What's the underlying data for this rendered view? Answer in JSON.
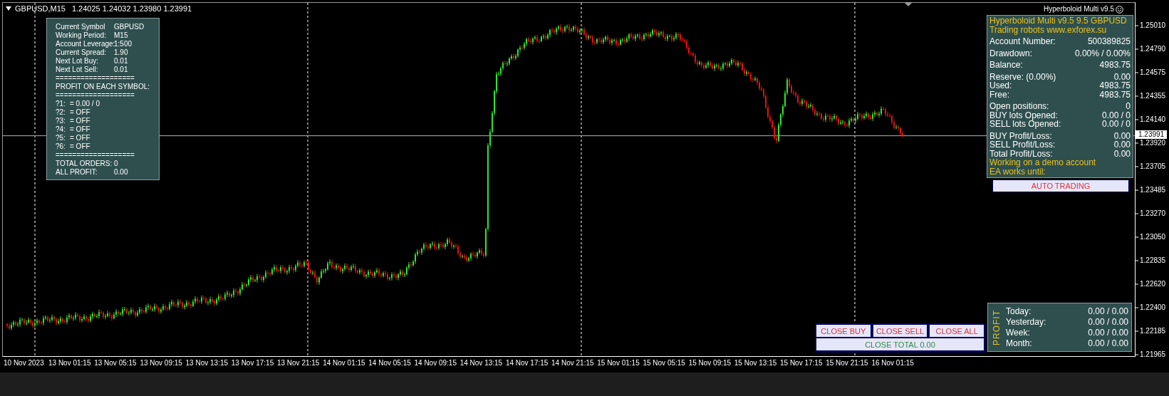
{
  "chart": {
    "symbol_period": "GBPUSD,M15",
    "quote": "1.24025 1.24032 1.23980 1.23991",
    "current_price": "1.23991",
    "price_axis": [
      "1.25010",
      "1.24790",
      "1.24575",
      "1.24355",
      "1.24140",
      "1.23920",
      "1.23705",
      "1.23485",
      "1.23270",
      "1.23050",
      "1.22835",
      "1.22620",
      "1.22400",
      "1.22185",
      "1.21965"
    ],
    "time_axis": [
      "10 Nov 2023",
      "13 Nov 01:15",
      "13 Nov 05:15",
      "13 Nov 09:15",
      "13 Nov 13:15",
      "13 Nov 17:15",
      "13 Nov 21:15",
      "14 Nov 01:15",
      "14 Nov 05:15",
      "14 Nov 09:15",
      "14 Nov 13:15",
      "14 Nov 17:15",
      "14 Nov 21:15",
      "15 Nov 01:15",
      "15 Nov 05:15",
      "15 Nov 09:15",
      "15 Nov 13:15",
      "15 Nov 17:15",
      "15 Nov 21:15",
      "16 Nov 01:15"
    ]
  },
  "info_panel": {
    "lines": [
      {
        "kind": "pair",
        "label": "Current Symbol",
        "value": "GBPUSD"
      },
      {
        "kind": "pair",
        "label": "Working Period:",
        "value": "M15"
      },
      {
        "kind": "pair",
        "label": "Account Leverage:",
        "value": "1:500"
      },
      {
        "kind": "pair",
        "label": "Current Spread:",
        "value": "1.90"
      },
      {
        "kind": "pair",
        "label": "Next Lot Buy:",
        "value": "0.01"
      },
      {
        "kind": "pair",
        "label": "Next Lot Sell:",
        "value": "0.01"
      },
      {
        "kind": "text",
        "text": "==================="
      },
      {
        "kind": "text",
        "text": "PROFIT ON EACH SYMBOL:"
      },
      {
        "kind": "text",
        "text": "==================="
      },
      {
        "kind": "slot",
        "label": "?1:",
        "value": "= 0.00 / 0"
      },
      {
        "kind": "slot",
        "label": "?2:",
        "value": "= OFF"
      },
      {
        "kind": "slot",
        "label": "?3:",
        "value": "= OFF"
      },
      {
        "kind": "slot",
        "label": "?4:",
        "value": "= OFF"
      },
      {
        "kind": "slot",
        "label": "?5:",
        "value": "= OFF"
      },
      {
        "kind": "slot",
        "label": "?6:",
        "value": "= OFF"
      },
      {
        "kind": "text",
        "text": "==================="
      },
      {
        "kind": "pair",
        "label": "TOTAL ORDERS:",
        "value": "0"
      },
      {
        "kind": "pair",
        "label": "ALL PROFIT:",
        "value": "0.00"
      }
    ]
  },
  "ea_panel": {
    "caption": "Hyperboloid Multi v9.5",
    "sections": [
      [
        {
          "kind": "note",
          "text": "Hyperboloid Multi v9.5 9.5 GBPUSD"
        },
        {
          "kind": "note",
          "text": "Trading robots www.exforex.su"
        }
      ],
      [
        {
          "kind": "pair",
          "label": "Account Number:",
          "value": "500389825"
        }
      ],
      [
        {
          "kind": "pair",
          "label": "Drawdown:",
          "value": "0.00% / 0.00%"
        }
      ],
      [
        {
          "kind": "pair",
          "label": "Balance:",
          "value": "4983.75"
        }
      ],
      [
        {
          "kind": "pair",
          "label": "Reserve: (0.00%)",
          "value": "0.00"
        },
        {
          "kind": "pair",
          "label": "Used:",
          "value": "4983.75"
        },
        {
          "kind": "pair",
          "label": "Free:",
          "value": "4983.75"
        }
      ],
      [
        {
          "kind": "pair",
          "label": "Open positions:",
          "value": "0"
        },
        {
          "kind": "pair",
          "label": "BUY lots Opened:",
          "value": "0.00 / 0"
        },
        {
          "kind": "pair",
          "label": "SELL lots Opened:",
          "value": "0.00 / 0"
        }
      ],
      [
        {
          "kind": "pair",
          "label": "BUY Profit/Loss:",
          "value": "0.00"
        },
        {
          "kind": "pair",
          "label": "SELL Profit/Loss:",
          "value": "0.00"
        },
        {
          "kind": "pair",
          "label": "Total Profit/Loss:",
          "value": "0.00"
        },
        {
          "kind": "note",
          "text": "Working on a demo account"
        },
        {
          "kind": "note",
          "text": "EA works until:"
        }
      ]
    ],
    "auto_trading_button": "AUTO TRADING"
  },
  "close_buttons": [
    {
      "label": "CLOSE BUY",
      "color": "#e0303a"
    },
    {
      "label": "CLOSE SELL",
      "color": "#e0303a"
    },
    {
      "label": "CLOSE ALL",
      "color": "#e0303a"
    }
  ],
  "close_total_button": {
    "label": "CLOSE TOTAL 0.00",
    "color": "#2e8b3e"
  },
  "profit_panel": {
    "title": "PROFIT",
    "rows": [
      {
        "label": "Today:",
        "value": "0.00 / 0.00"
      },
      {
        "label": "Yesterday:",
        "value": "0.00 / 0.00"
      },
      {
        "label": "Week:",
        "value": "0.00 / 0.00"
      },
      {
        "label": "Month:",
        "value": "0.00 / 0.00"
      }
    ]
  }
}
